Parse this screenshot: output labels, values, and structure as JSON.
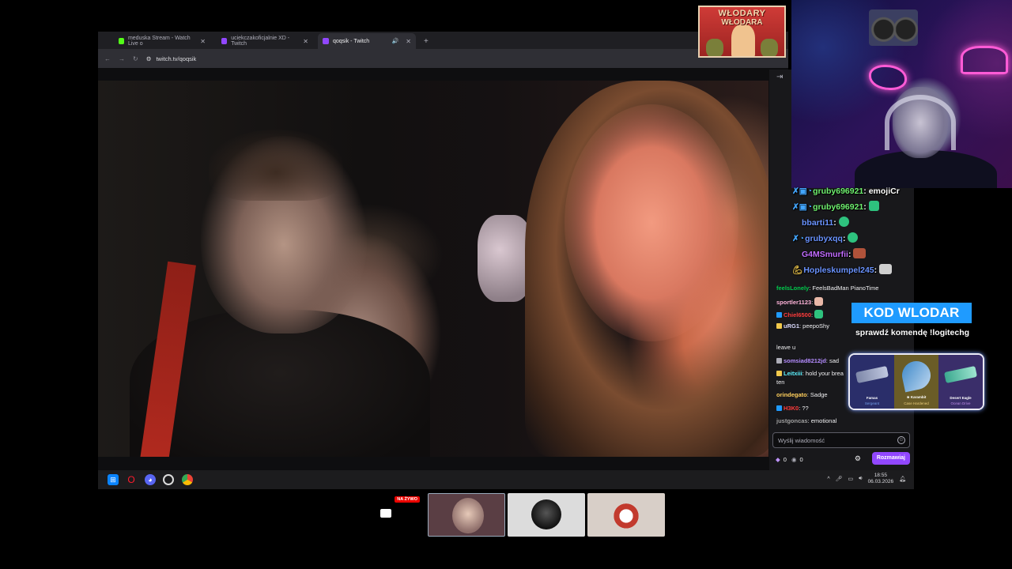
{
  "browser": {
    "tabs": [
      {
        "title": "meduska Stream - Watch Live o",
        "favicon_color": "#53fc18"
      },
      {
        "title": "uciekczakoficjalnie XD - Twitch",
        "favicon_color": "#9147ff"
      },
      {
        "title": "qoqsik - Twitch",
        "favicon_color": "#9147ff",
        "active": true
      }
    ],
    "url": "twitch.tv/qoqsik"
  },
  "chat": {
    "lines": [
      {
        "user": "feelsLonely",
        "user_color": "#00c94c",
        "text": ": FeelsBadMan PianoTime"
      },
      {
        "user": "sportler1123",
        "user_color": "#ffb3d9",
        "text": ":"
      },
      {
        "user": "Chiel6500",
        "user_color": "#ff3b3b",
        "text": ":"
      },
      {
        "user": "uRG1",
        "user_color": "#dcdcff",
        "text": ": peepoShy"
      },
      {
        "user": "leave u",
        "user_color": "#efeff1",
        "text": ""
      },
      {
        "user": "somsiad8212jd",
        "user_color": "#b48cff",
        "text": ": sad"
      },
      {
        "user": "Leitxiii",
        "user_color": "#5cf2ff",
        "text": ": hold your brea"
      },
      {
        "user": "ten",
        "user_color": "#efeff1",
        "text": ""
      },
      {
        "user": "orindegato",
        "user_color": "#ffcf5c",
        "text": ": Sadge"
      },
      {
        "user": "H3K0",
        "user_color": "#ff3b3b",
        "text": ": ??"
      },
      {
        "user": "justgoncas",
        "user_color": "#a0a0a0",
        "text": ": emotional"
      }
    ],
    "input_placeholder": "Wyślij wiadomość",
    "bits_count": "0",
    "points_count": "0",
    "send_label": "Rozmawiaj"
  },
  "overlay_chat": [
    {
      "user": "gruby696921",
      "color": "#6ff06f",
      "text": ": emojiCr"
    },
    {
      "user": "gruby696921",
      "color": "#6ff06f",
      "text": ":"
    },
    {
      "user": "bbarti11",
      "color": "#6a93ff",
      "text": ":"
    },
    {
      "user": "grubyxqq",
      "color": "#6a93ff",
      "text": ":"
    },
    {
      "user": "G4MSmurfii",
      "color": "#c16bff",
      "text": ":"
    },
    {
      "user": "Hopleskumpel245",
      "color": "#6a93ff",
      "text": ":"
    }
  ],
  "promo": {
    "code": "KOD WLODAR",
    "subtitle": "sprawdź komendę !logitechg"
  },
  "skins": [
    {
      "name": "Famas",
      "sub": "Sergeant",
      "bg": "#2a2e6a"
    },
    {
      "name": "★ Karambit",
      "sub": "Case Hardened",
      "bg": "#6a5c27"
    },
    {
      "name": "Desert Eagle",
      "sub": "Ocean Drive",
      "bg": "#3a2e6a"
    }
  ],
  "logo": {
    "line1": "WŁODARY",
    "line2": "WŁODARA"
  },
  "tiles": {
    "live_badge": "NA ŻYWO"
  },
  "taskbar": {
    "time": "18:55",
    "date": "06.03.2026"
  }
}
